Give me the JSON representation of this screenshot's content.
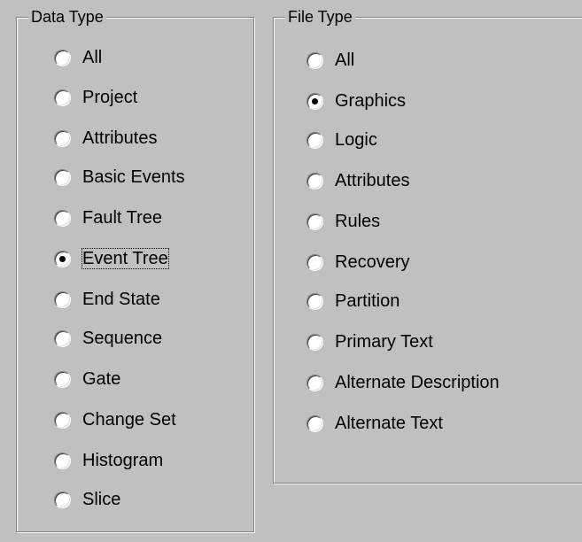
{
  "data_type": {
    "title": "Data Type",
    "selected": "Event Tree",
    "options": [
      "All",
      "Project",
      "Attributes",
      "Basic Events",
      "Fault Tree",
      "Event Tree",
      "End State",
      "Sequence",
      "Gate",
      "Change Set",
      "Histogram",
      "Slice"
    ]
  },
  "file_type": {
    "title": "File Type",
    "selected": "Graphics",
    "options": [
      "All",
      "Graphics",
      "Logic",
      "Attributes",
      "Rules",
      "Recovery",
      "Partition",
      "Primary Text",
      "Alternate Description",
      "Alternate Text"
    ]
  }
}
